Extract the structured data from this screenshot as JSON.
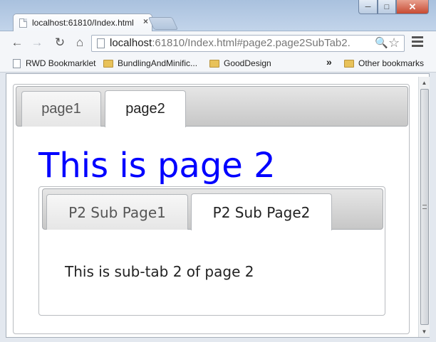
{
  "browser": {
    "tab_title": "localhost:61810/Index.html",
    "tab_close": "×",
    "window_buttons": {
      "minimize": "─",
      "maximize": "□",
      "close": "✕"
    },
    "nav": {
      "back": "←",
      "forward": "→",
      "reload": "↻",
      "home": "⌂"
    },
    "url_host": "localhost",
    "url_rest": ":61810/Index.html#page2.page2SubTab2.",
    "zoom": "🔍",
    "star": "☆",
    "bookmarks": [
      {
        "label": "RWD Bookmarklet",
        "icon": "page-icon"
      },
      {
        "label": "BundlingAndMinific...",
        "icon": "folder-icon"
      },
      {
        "label": "GoodDesign",
        "icon": "folder-icon"
      }
    ],
    "bookmarks_overflow": "»",
    "other_bookmarks": "Other bookmarks",
    "scroll_up": "▲",
    "scroll_down": "▼"
  },
  "page": {
    "tabs": [
      {
        "label": "page1",
        "active": false
      },
      {
        "label": "page2",
        "active": true
      }
    ],
    "heading": "This is page 2",
    "heading_color": "#0000ff",
    "sub_tabs": [
      {
        "label": "P2 Sub Page1",
        "active": false
      },
      {
        "label": "P2 Sub Page2",
        "active": true
      }
    ],
    "sub_content": "This is sub-tab 2 of page 2"
  }
}
